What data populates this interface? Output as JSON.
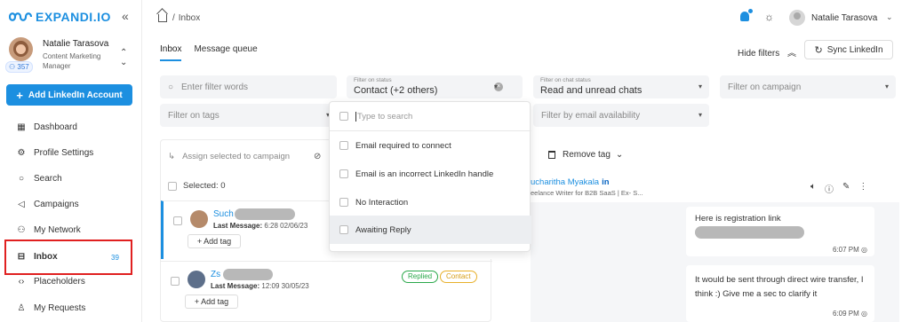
{
  "brand": {
    "name": "EXPANDI.IO",
    "accent": "#1c8fe0"
  },
  "sidebar": {
    "collapse_icon": "«",
    "profile": {
      "name": "Natalie Tarasova",
      "role": "Content Marketing Manager",
      "connections": "357"
    },
    "add_button": "Add LinkedIn Account",
    "items": [
      {
        "label": "Dashboard",
        "icon": "dashboard-icon"
      },
      {
        "label": "Profile Settings",
        "icon": "gear-icon"
      },
      {
        "label": "Search",
        "icon": "search-icon"
      },
      {
        "label": "Campaigns",
        "icon": "megaphone-icon"
      },
      {
        "label": "My Network",
        "icon": "network-icon"
      },
      {
        "label": "Inbox",
        "icon": "inbox-icon",
        "count": "39",
        "highlight_color": "#e02020"
      },
      {
        "label": "Placeholders",
        "icon": "code-icon"
      },
      {
        "label": "My Requests",
        "icon": "person-request-icon"
      }
    ]
  },
  "topbar": {
    "breadcrumb": "Inbox",
    "user_name": "Natalie Tarasova"
  },
  "tabs": [
    {
      "label": "Inbox",
      "active": true
    },
    {
      "label": "Message queue",
      "active": false
    }
  ],
  "actions": {
    "hide_filters": "Hide filters",
    "sync": "Sync LinkedIn"
  },
  "filters": {
    "search_placeholder": "Enter filter words",
    "status_label": "Filter on status",
    "status_value": "Contact (+2 others)",
    "chat_status_label": "Filter on chat status",
    "chat_status_value": "Read and unread chats",
    "campaign_placeholder": "Filter on campaign",
    "tags_placeholder": "Filter on tags",
    "email_placeholder": "Filter by email availability"
  },
  "dropdown": {
    "search_placeholder": "Type to search",
    "options": [
      "Email required to connect",
      "Email is an incorrect LinkedIn handle",
      "No Interaction",
      "Awaiting Reply"
    ]
  },
  "list": {
    "assign_label": "Assign selected to campaign",
    "selected_label": "Selected: 0",
    "add_tag": "+ Add tag",
    "rows": [
      {
        "name_prefix": "Such",
        "last_message_label": "Last Message:",
        "last_message": "6:28 02/06/23",
        "badges": []
      },
      {
        "name_prefix": "Zs",
        "last_message_label": "Last Message:",
        "last_message": "12:09 30/05/23",
        "badges": [
          "Replied",
          "Contact"
        ]
      }
    ]
  },
  "chat": {
    "remove_tag": "Remove tag",
    "name": "ucharitha Myakala",
    "linkedin_badge": "in",
    "subtitle": "eelance Writer for B2B SaaS | Ex- S...",
    "messages": [
      {
        "text": "Here is registration link",
        "time": "6:07 PM"
      },
      {
        "text": "It would be sent through direct wire transfer, I think :) Give me a sec to clarify it",
        "time": "6:09 PM"
      }
    ]
  }
}
